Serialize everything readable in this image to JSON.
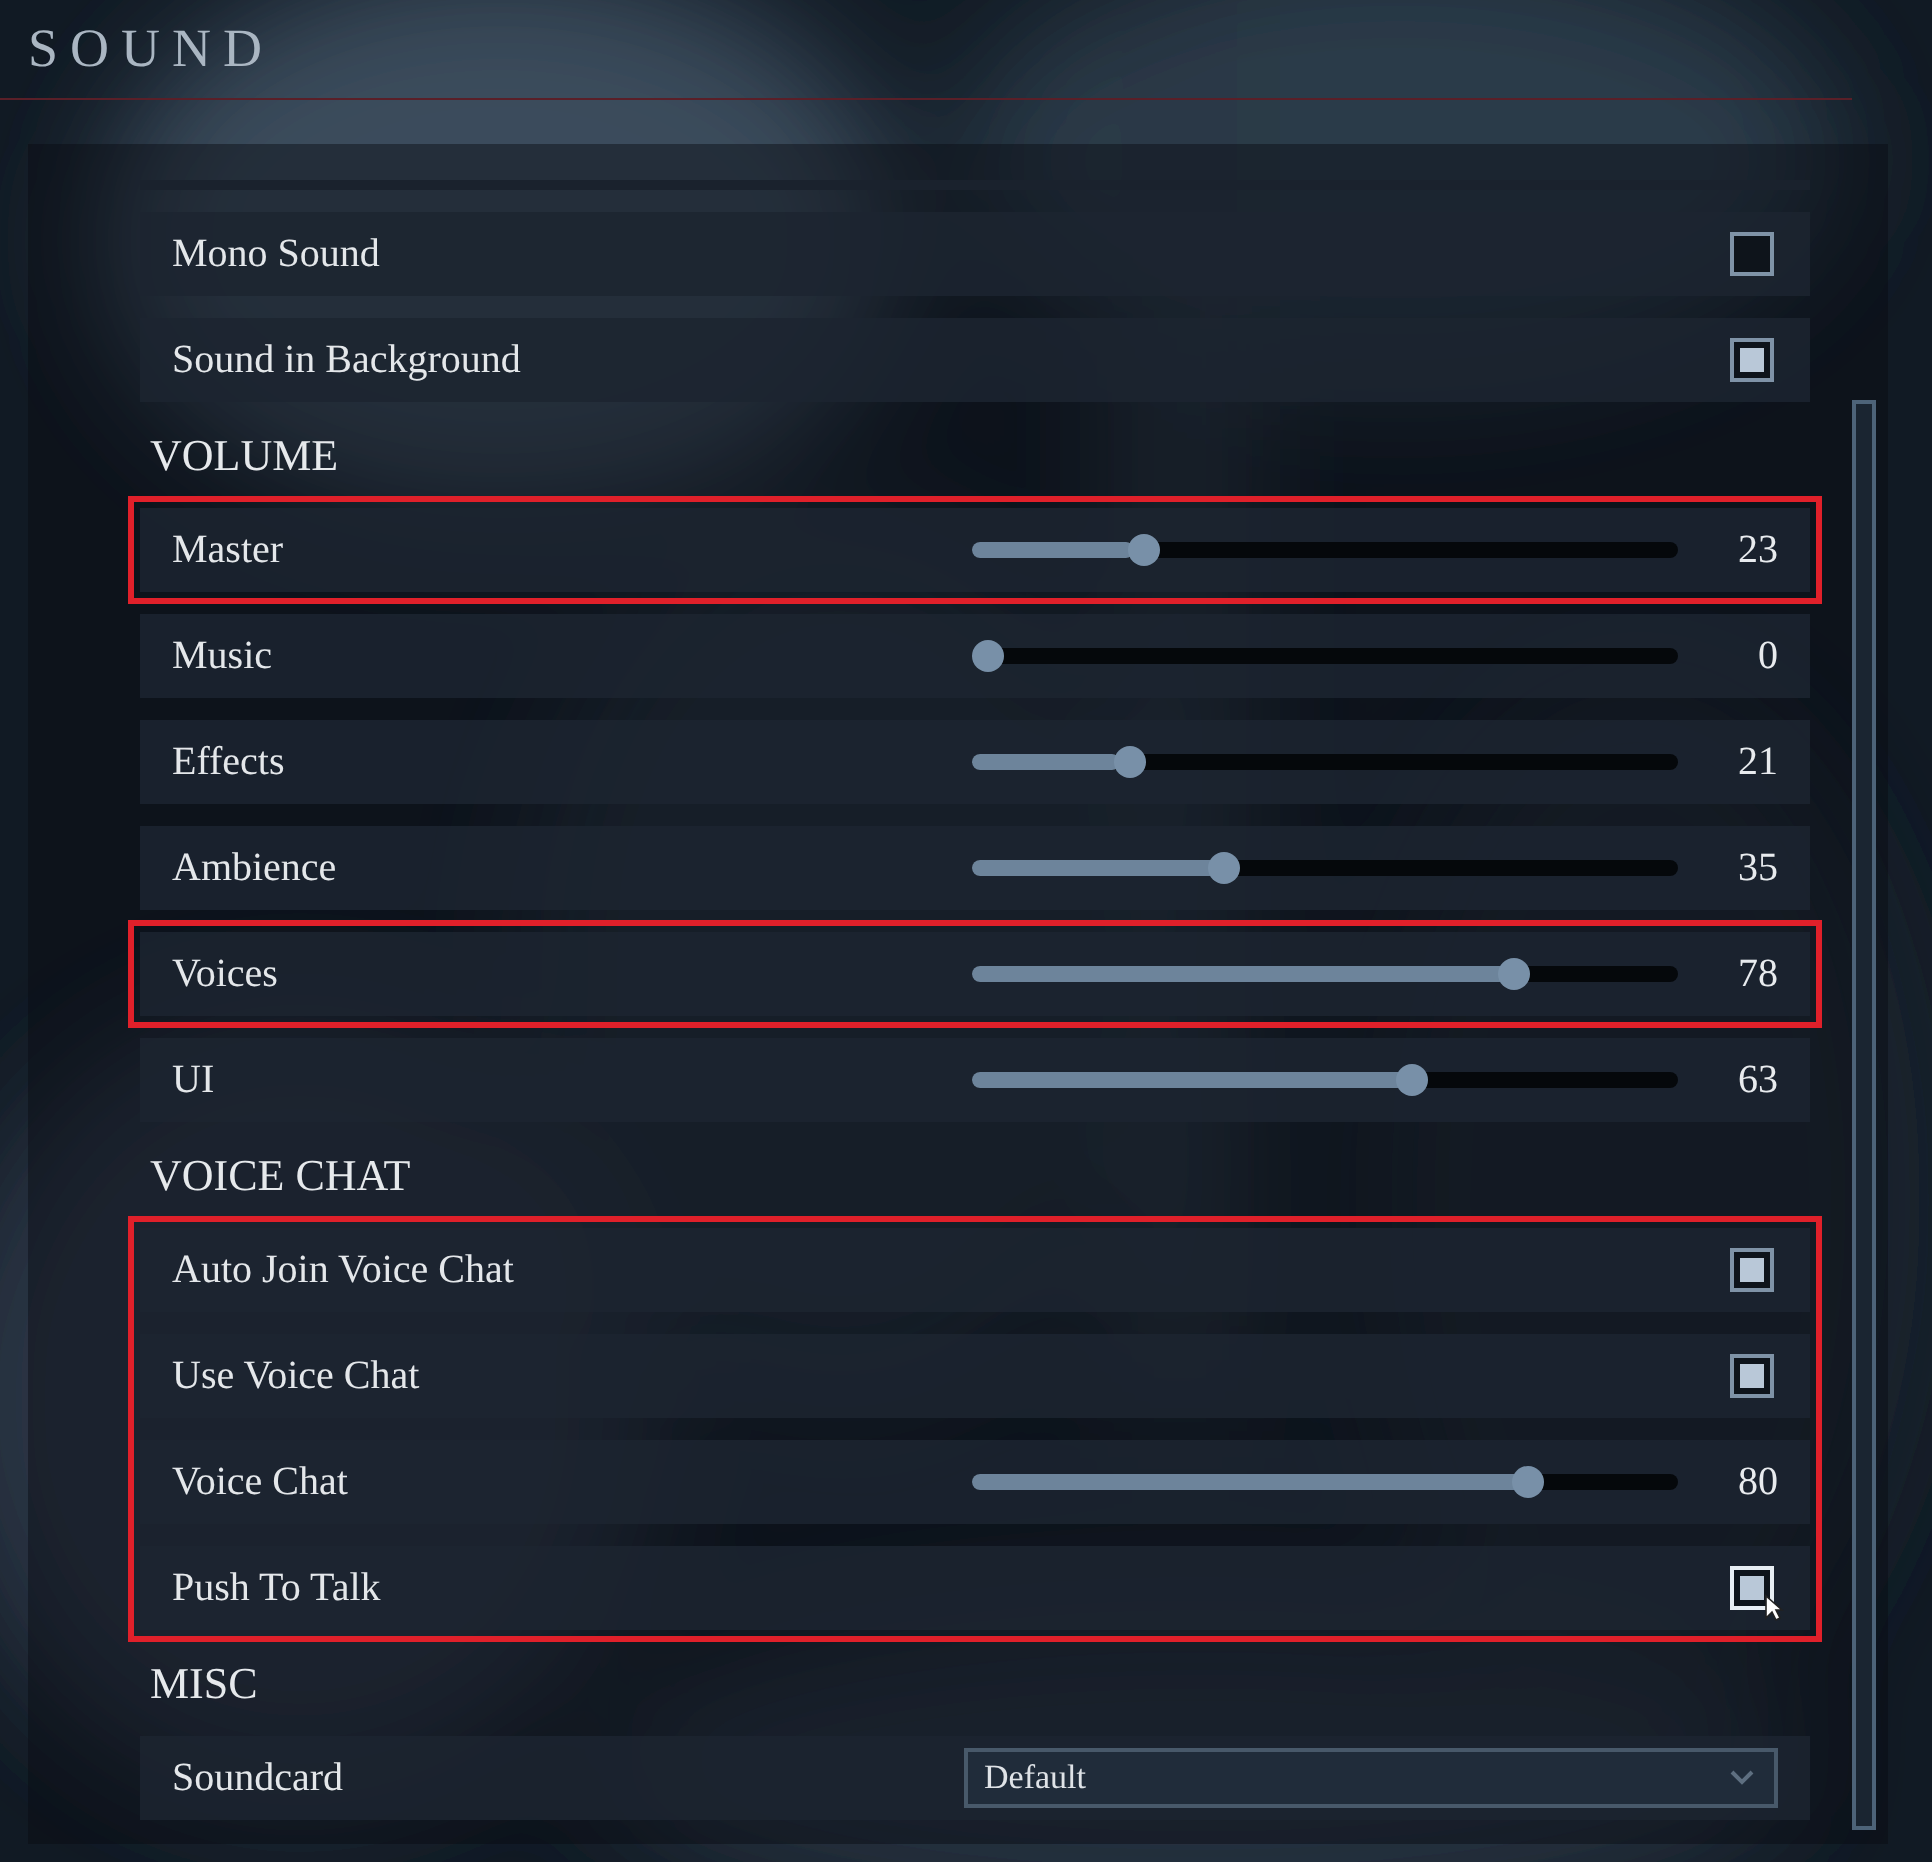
{
  "title": "SOUND",
  "sections": [
    {
      "highlighted": false,
      "rows": [
        {
          "kind": "checkbox",
          "label": "Mono Sound",
          "checked": false,
          "hovered": false,
          "highlighted": false
        },
        {
          "kind": "checkbox",
          "label": "Sound in Background",
          "checked": true,
          "hovered": false,
          "highlighted": false
        }
      ]
    },
    {
      "title": "VOLUME",
      "highlighted": false,
      "rows": [
        {
          "kind": "slider",
          "label": "Master",
          "level": 0.23,
          "reading": "23",
          "highlighted": true
        },
        {
          "kind": "slider",
          "label": "Music",
          "level": 0,
          "reading": "0",
          "highlighted": false
        },
        {
          "kind": "slider",
          "label": "Effects",
          "level": 0.21,
          "reading": "21",
          "highlighted": false
        },
        {
          "kind": "slider",
          "label": "Ambience",
          "level": 0.35,
          "reading": "35",
          "highlighted": false
        },
        {
          "kind": "slider",
          "label": "Voices",
          "level": 0.78,
          "reading": "78",
          "highlighted": true
        },
        {
          "kind": "slider",
          "label": "UI",
          "level": 0.63,
          "reading": "63",
          "highlighted": false
        }
      ]
    },
    {
      "title": "VOICE CHAT",
      "highlighted": true,
      "rows": [
        {
          "kind": "checkbox",
          "label": "Auto Join Voice Chat",
          "checked": true,
          "hovered": false,
          "highlighted": false
        },
        {
          "kind": "checkbox",
          "label": "Use Voice Chat",
          "checked": true,
          "hovered": false,
          "highlighted": false
        },
        {
          "kind": "slider",
          "label": "Voice Chat",
          "level": 0.8,
          "reading": "80",
          "highlighted": false
        },
        {
          "kind": "checkbox",
          "label": "Push To Talk",
          "checked": true,
          "hovered": true,
          "highlighted": false
        }
      ]
    },
    {
      "title": "MISC",
      "highlighted": false,
      "rows": [
        {
          "kind": "dropdown",
          "label": "Soundcard",
          "value": "Default",
          "highlighted": false
        }
      ]
    }
  ]
}
